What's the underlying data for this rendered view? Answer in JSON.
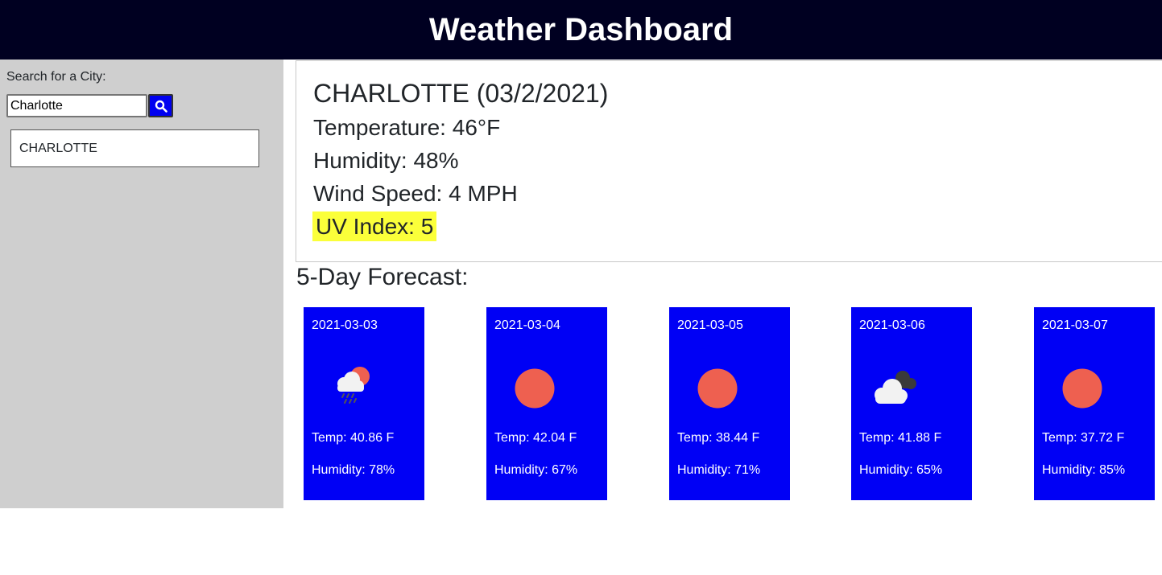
{
  "header": {
    "title": "Weather Dashboard"
  },
  "sidebar": {
    "search_label": "Search for a City:",
    "search_value": "Charlotte",
    "search_button_icon": "search-icon",
    "history": [
      "CHARLOTTE"
    ]
  },
  "current": {
    "title": "CHARLOTTE (03/2/2021)",
    "temperature": "Temperature: 46°F",
    "humidity": "Humidity: 48%",
    "wind": "Wind Speed: 4 MPH",
    "uv": "UV Index: 5",
    "uv_color": "#fbff3a"
  },
  "forecast": {
    "title": "5-Day Forecast:",
    "card_color": "#0000f5",
    "days": [
      {
        "date": "2021-03-03",
        "icon": "sun-cloud-rain-icon",
        "temp": "Temp: 40.86 F",
        "humidity": "Humidity: 78%"
      },
      {
        "date": "2021-03-04",
        "icon": "sun-icon",
        "temp": "Temp: 42.04 F",
        "humidity": "Humidity: 67%"
      },
      {
        "date": "2021-03-05",
        "icon": "sun-icon",
        "temp": "Temp: 38.44 F",
        "humidity": "Humidity: 71%"
      },
      {
        "date": "2021-03-06",
        "icon": "broken-clouds-icon",
        "temp": "Temp: 41.88 F",
        "humidity": "Humidity: 65%"
      },
      {
        "date": "2021-03-07",
        "icon": "sun-icon",
        "temp": "Temp: 37.72 F",
        "humidity": "Humidity: 85%"
      }
    ]
  }
}
